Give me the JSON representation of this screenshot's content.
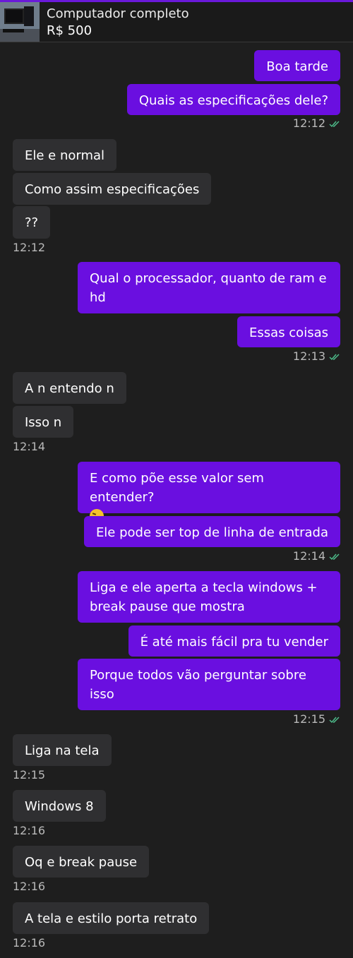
{
  "header": {
    "product_title": "Computador completo",
    "price": "R$ 500",
    "thumbnail_icon": "computer-photo-icon"
  },
  "colors": {
    "outgoing_bubble": "#6a0fe0",
    "incoming_bubble": "#2f2f31",
    "background": "#1e1e1e",
    "read_tick": "#4fc18e"
  },
  "messages": [
    {
      "dir": "out",
      "text": "Boa tarde"
    },
    {
      "dir": "out",
      "text": "Quais as especificações dele?"
    },
    {
      "dir": "in",
      "text": "Ele e normal"
    },
    {
      "dir": "in",
      "text": "Como assim especificações"
    },
    {
      "dir": "in",
      "text": "??"
    },
    {
      "dir": "out",
      "text": "Qual o processador, quanto de ram e hd"
    },
    {
      "dir": "out",
      "text": "Essas coisas"
    },
    {
      "dir": "in",
      "text": "A n entendo n"
    },
    {
      "dir": "in",
      "text": "Isso n"
    },
    {
      "dir": "out",
      "text": "E como põe esse valor sem entender?",
      "emoji": "grinning-sweat-emoji"
    },
    {
      "dir": "out",
      "text": "Ele pode ser top de linha de entrada"
    },
    {
      "dir": "out",
      "text": "Liga e ele aperta a tecla windows + break pause que mostra"
    },
    {
      "dir": "out",
      "text": "É até mais fácil pra tu vender"
    },
    {
      "dir": "out",
      "text": "Porque todos vão perguntar sobre isso"
    },
    {
      "dir": "in",
      "text": "Liga na tela"
    },
    {
      "dir": "in",
      "text": "Windows 8"
    },
    {
      "dir": "in",
      "text": "Oq e break pause"
    },
    {
      "dir": "in",
      "text": "A tela e estilo porta retrato"
    }
  ],
  "timestamps": [
    {
      "text": "12:12",
      "dir": "out",
      "read": true
    },
    {
      "text": "12:12",
      "dir": "in"
    },
    {
      "text": "12:13",
      "dir": "out",
      "read": true
    },
    {
      "text": "12:14",
      "dir": "in"
    },
    {
      "text": "12:14",
      "dir": "out",
      "read": true
    },
    {
      "text": "12:15",
      "dir": "out",
      "read": true
    },
    {
      "text": "12:15",
      "dir": "in"
    },
    {
      "text": "12:16",
      "dir": "in"
    },
    {
      "text": "12:16",
      "dir": "in"
    },
    {
      "text": "12:16",
      "dir": "in"
    }
  ]
}
